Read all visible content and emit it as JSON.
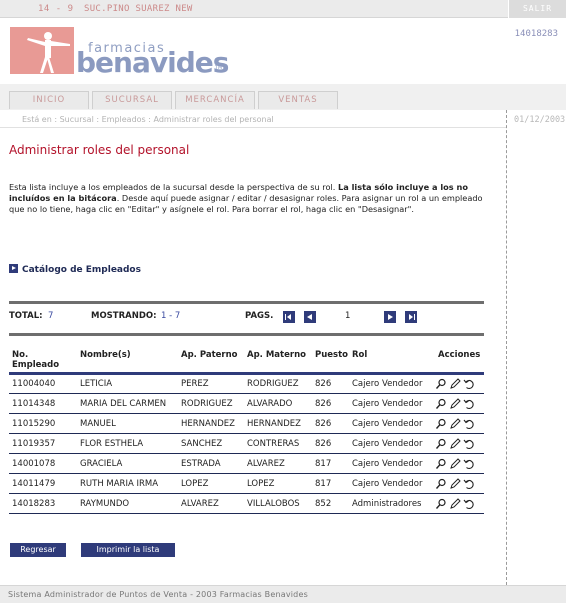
{
  "topbar": {
    "code": "14 - 9",
    "branch": "SUC.PINO SUAREZ NEW",
    "logout_label": "SALIR"
  },
  "header": {
    "logo_small": "farmacias",
    "logo_big": "benavides",
    "user_id": "14018283"
  },
  "tabs": [
    {
      "label": "INICIO"
    },
    {
      "label": "SUCURSAL"
    },
    {
      "label": "MERCANCÍA"
    },
    {
      "label": "VENTAS"
    }
  ],
  "breadcrumb": {
    "prefix": "Está en :",
    "items": [
      "Sucursal",
      "Empleados",
      "Administrar roles del personal"
    ]
  },
  "date": "01/12/2003",
  "page": {
    "title": "Administrar roles del personal",
    "intro_part1": "Esta lista incluye a los empleados de la sucursal desde la perspectiva de su rol. ",
    "intro_bold": "La lista sólo incluye a los no incluídos en la bitácora",
    "intro_part2": ". Desde aquí puede asignar / editar / desasignar roles. Para asignar un rol a un empleado que no lo tiene, haga clic en \"Editar\" y asígnele el rol. Para borrar el rol, haga clic en \"Desasignar\".",
    "catalog_link": "Catálogo de Empleados"
  },
  "pager": {
    "total_label": "TOTAL:",
    "total_value": "7",
    "showing_label": "MOSTRANDO:",
    "showing_value": "1 - 7",
    "pages_label": "PAGS.",
    "current_page": "1"
  },
  "table": {
    "headers": {
      "employee_no": "No. Empleado",
      "names": "Nombre(s)",
      "paternal": "Ap. Paterno",
      "maternal": "Ap. Materno",
      "position": "Puesto",
      "role": "Rol",
      "actions": "Acciones"
    },
    "rows": [
      {
        "no": "11004040",
        "name": "LETICIA",
        "paternal": "PEREZ",
        "maternal": "RODRIGUEZ",
        "position": "826",
        "role": "Cajero Vendedor"
      },
      {
        "no": "11014348",
        "name": "MARIA DEL CARMEN",
        "paternal": "RODRIGUEZ",
        "maternal": "ALVARADO",
        "position": "826",
        "role": "Cajero Vendedor"
      },
      {
        "no": "11015290",
        "name": "MANUEL",
        "paternal": "HERNANDEZ",
        "maternal": "HERNANDEZ",
        "position": "826",
        "role": "Cajero Vendedor"
      },
      {
        "no": "11019357",
        "name": "FLOR ESTHELA",
        "paternal": "SANCHEZ",
        "maternal": "CONTRERAS",
        "position": "826",
        "role": "Cajero Vendedor"
      },
      {
        "no": "14001078",
        "name": "GRACIELA",
        "paternal": "ESTRADA",
        "maternal": "ALVAREZ",
        "position": "817",
        "role": "Cajero Vendedor"
      },
      {
        "no": "14011479",
        "name": "RUTH MARIA IRMA",
        "paternal": "LOPEZ",
        "maternal": "LOPEZ",
        "position": "817",
        "role": "Cajero Vendedor"
      },
      {
        "no": "14018283",
        "name": "RAYMUNDO",
        "paternal": "ALVAREZ",
        "maternal": "VILLALOBOS",
        "position": "852",
        "role": "Administradores"
      }
    ]
  },
  "buttons": {
    "back": "Regresar",
    "print": "Imprimir la lista"
  },
  "footer": "Sistema Administrador de Puntos de Venta - 2003 Farmacias Benavides",
  "colors": {
    "accent": "#2f3b7a",
    "title": "#b3122a",
    "tab_text": "#c99a9a"
  }
}
